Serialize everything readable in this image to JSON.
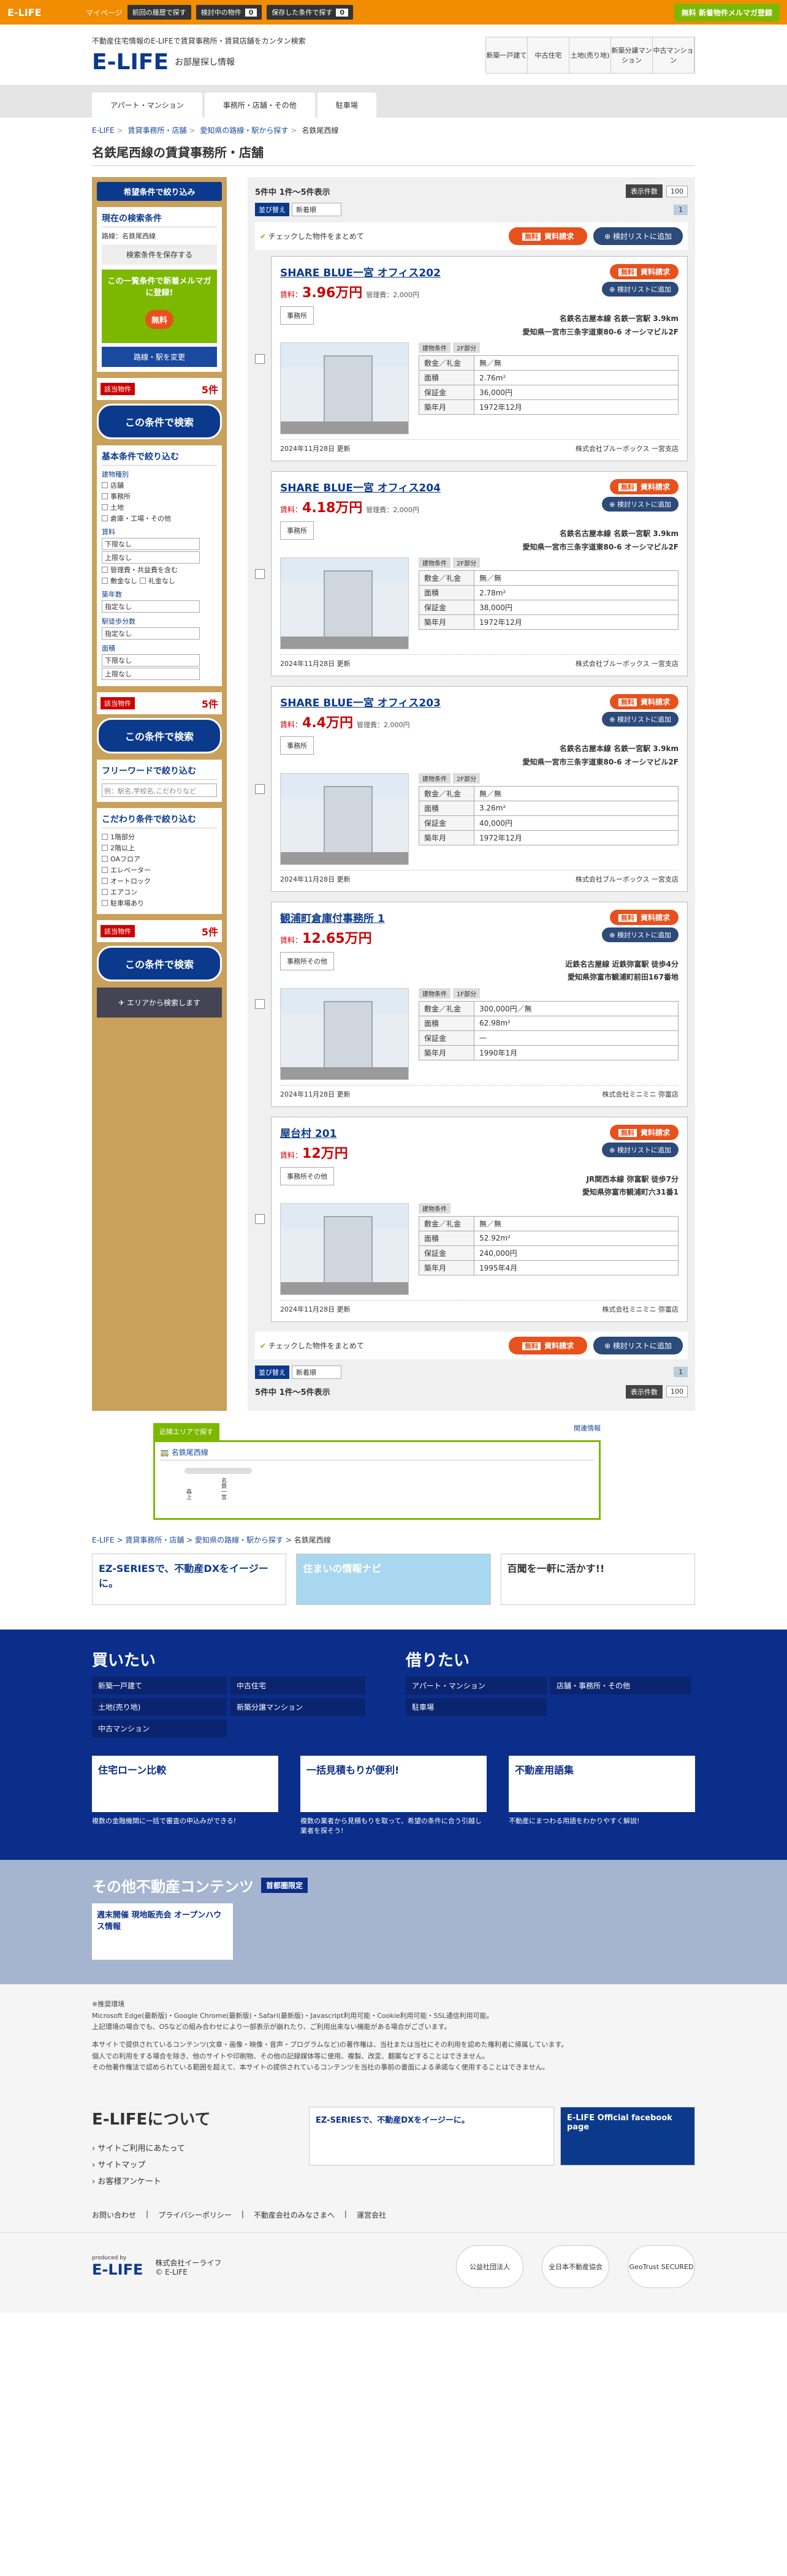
{
  "topbar": {
    "logo": "E-LIFE",
    "mypage": "マイページ",
    "history": "前回の履歴で探す",
    "compare": "検討中の物件",
    "compare_count": "0",
    "saved": "保存した条件で探す",
    "saved_count": "0",
    "mail_badge": "無料",
    "mail": "新着物件メルマガ登録"
  },
  "header": {
    "desc": "不動産住宅情報のE-LIFEで賃貸事務所・賃貸店舗をカンタン検索",
    "logo": "E-LIFE",
    "sub": "お部屋探し情報",
    "nav": [
      "新築一戸建て",
      "中古住宅",
      "土地(売り地)",
      "新築分譲マンション",
      "中古マンション"
    ]
  },
  "gnav": [
    "アパート・マンション",
    "事務所・店舗・その他",
    "駐車場"
  ],
  "breadcrumb": [
    "E-LIFE",
    "賃貸事務所・店舗",
    "愛知県の路線・駅から探す",
    "名鉄尾西線"
  ],
  "page_title": "名鉄尾西線の賃貸事務所・店舗",
  "side": {
    "header": "希望条件で絞り込み",
    "current_title": "現在の検索条件",
    "current_line": "路線：名鉄尾西線",
    "save_btn": "検索条件を保存する",
    "banner_text": "この一覧条件で新着メルマガに登録!",
    "banner_badge": "無料",
    "change_btn": "路線・駅を変更",
    "count_tag": "該当物件",
    "count": "5件",
    "go": "この条件で検索",
    "basic_title": "基本条件で絞り込む",
    "type_label": "建物種別",
    "types": [
      "店舗",
      "事務所",
      "土地",
      "倉庫・工場・その他"
    ],
    "rent_label": "賃料",
    "rent_low": "下限なし",
    "rent_high": "上限なし",
    "rent_opts": [
      "管理費・共益費を含む",
      "敷金なし",
      "礼金なし"
    ],
    "age_label": "築年数",
    "age_val": "指定なし",
    "walk_label": "駅徒歩分数",
    "walk_val": "指定なし",
    "area_label": "面積",
    "area_low": "下限なし",
    "area_high": "上限なし",
    "free_title": "フリーワードで絞り込む",
    "free_ph": "例：駅名,学校名,こだわりなど",
    "kodawari_title": "こだわり条件で絞り込む",
    "kodawari": [
      "1階部分",
      "2階以上",
      "OAフロア",
      "エレベーター",
      "オートロック",
      "エアコン",
      "駐車場あり"
    ],
    "area_search": "エリアから検索します"
  },
  "results": {
    "count_text": "5件中 1件～5件表示",
    "per_page_label": "表示件数",
    "per_page": "100",
    "sort_label": "並び替え",
    "sort_val": "新着順",
    "page": "1",
    "check_text": "チェックした物件をまとめて",
    "req_badge": "無料",
    "req": "資料請求",
    "add_list": "検討リストに追加",
    "listings": [
      {
        "name": "SHARE BLUE一宮 オフィス202",
        "rent_label": "賃料：",
        "rent": "3.96万円",
        "fee": "管理費：2,000円",
        "type": "事務所",
        "loc1": "名鉄名古屋本線 名鉄一宮駅 3.9km",
        "loc2": "愛知県一宮市三条字道東80-6 オーシマビル2F",
        "tags": [
          "建物条件",
          "2F部分"
        ],
        "rows": [
          [
            "敷金／礼金",
            "無／無"
          ],
          [
            "面積",
            "2.76m²"
          ],
          [
            "保証金",
            "36,000円"
          ],
          [
            "築年月",
            "1972年12月"
          ]
        ],
        "date": "2024年11月28日 更新",
        "agent": "株式会社ブルーボックス 一宮支店"
      },
      {
        "name": "SHARE BLUE一宮 オフィス204",
        "rent_label": "賃料：",
        "rent": "4.18万円",
        "fee": "管理費：2,000円",
        "type": "事務所",
        "loc1": "名鉄名古屋本線 名鉄一宮駅 3.9km",
        "loc2": "愛知県一宮市三条字道東80-6 オーシマビル2F",
        "tags": [
          "建物条件",
          "2F部分"
        ],
        "rows": [
          [
            "敷金／礼金",
            "無／無"
          ],
          [
            "面積",
            "2.78m²"
          ],
          [
            "保証金",
            "38,000円"
          ],
          [
            "築年月",
            "1972年12月"
          ]
        ],
        "date": "2024年11月28日 更新",
        "agent": "株式会社ブルーボックス 一宮支店"
      },
      {
        "name": "SHARE BLUE一宮 オフィス203",
        "rent_label": "賃料：",
        "rent": "4.4万円",
        "fee": "管理費：2,000円",
        "type": "事務所",
        "loc1": "名鉄名古屋本線 名鉄一宮駅 3.9km",
        "loc2": "愛知県一宮市三条字道東80-6 オーシマビル2F",
        "tags": [
          "建物条件",
          "2F部分"
        ],
        "rows": [
          [
            "敷金／礼金",
            "無／無"
          ],
          [
            "面積",
            "3.26m²"
          ],
          [
            "保証金",
            "40,000円"
          ],
          [
            "築年月",
            "1972年12月"
          ]
        ],
        "date": "2024年11月28日 更新",
        "agent": "株式会社ブルーボックス 一宮支店"
      },
      {
        "name": "観浦町倉庫付事務所 1",
        "rent_label": "賃料：",
        "rent": "12.65万円",
        "fee": "",
        "type": "事務所その他",
        "loc1": "近鉄名古屋線 近鉄弥富駅 徒歩4分",
        "loc2": "愛知県弥富市観浦町前田167番地",
        "tags": [
          "建物条件",
          "1F部分"
        ],
        "rows": [
          [
            "敷金／礼金",
            "300,000円／無"
          ],
          [
            "面積",
            "62.98m²"
          ],
          [
            "保証金",
            "—"
          ],
          [
            "築年月",
            "1990年1月"
          ]
        ],
        "date": "2024年11月28日 更新",
        "agent": "株式会社ミニミニ 弥富店"
      },
      {
        "name": "屋台村 201",
        "rent_label": "賃料：",
        "rent": "12万円",
        "fee": "",
        "type": "事務所その他",
        "loc1": "JR関西本線 弥富駅 徒歩7分",
        "loc2": "愛知県弥富市観浦町六31番1",
        "tags": [
          "建物条件"
        ],
        "rows": [
          [
            "敷金／礼金",
            "無／無"
          ],
          [
            "面積",
            "52.92m²"
          ],
          [
            "保証金",
            "240,000円"
          ],
          [
            "築年月",
            "1995年4月"
          ]
        ],
        "date": "2024年11月28日 更新",
        "agent": "株式会社ミニミニ 弥富店"
      }
    ]
  },
  "near": {
    "tab": "近隣エリアで探す",
    "rel": "関連情報",
    "line": "名鉄尾西線",
    "stations": [
      "森上",
      "名鉄一宮"
    ]
  },
  "banners": [
    "EZ-SERIESで、不動産DXをイージーに。",
    "住まいの情報ナビ",
    "百聞を一軒に活かす!!"
  ],
  "buy": {
    "title": "買いたい",
    "links": [
      "新築一戸建て",
      "中古住宅",
      "土地(売り地)",
      "新築分譲マンション",
      "中古マンション"
    ]
  },
  "rent": {
    "title": "借りたい",
    "links": [
      "アパート・マンション",
      "店舗・事務所・その他",
      "駐車場"
    ]
  },
  "blue_banners": [
    {
      "title": "住宅ローン比較",
      "text": "複数の金融機関に一括で審査の申込みができる!"
    },
    {
      "title": "一括見積もりが便利!",
      "text": "複数の業者から見積もりを取って、希望の条件に合う引越し業者を探そう!"
    },
    {
      "title": "不動産用語集",
      "text": "不動産にまつわる用語をわかりやすく解説!"
    }
  ],
  "other": {
    "title": "その他不動産コンテンツ",
    "badge": "首都圏限定",
    "oh": "週末開催 現地販売会 オープンハウス情報"
  },
  "notes": [
    "※推奨環境",
    "Microsoft Edge(最新版)・Google Chrome(最新版)・Safari(最新版)・Javascript利用可能・Cookie利用可能・SSL通信利用可能。",
    "上記環境の場合でも、OSなどの組み合わせにより一部表示が崩れたり、ご利用出来ない機能がある場合がございます。",
    "本サイトで提供されているコンテンツ(文章・画像・映像・音声・プログラムなど)の著作権は、当社または当社にその利用を認めた権利者に帰属しています。",
    "個人での利用をする場合を除き、他のサイトや印刷物、その他の記録媒体等に使用、複製、改変、翻案などすることはできません。",
    "その他著作権法で認められている範囲を超えて、本サイトの提供されているコンテンツを当社の事前の書面による承諾なく使用することはできません。"
  ],
  "about": {
    "title": "E-LIFEについて",
    "links": [
      "サイトご利用にあたって",
      "サイトマップ",
      "お客様アンケート"
    ],
    "ez": "EZ-SERIESで、不動産DXをイージーに。",
    "fb": "E-LIFE Official facebook page"
  },
  "footer_links": [
    "お問い合わせ",
    "プライバシーポリシー",
    "不動産会社のみなさまへ",
    "運営会社"
  ],
  "footer": {
    "produced": "produced by",
    "logo": "E-LIFE",
    "company": "株式会社イーライフ",
    "copy": "© E-LIFE",
    "seals": [
      "公益社団法人",
      "全日本不動産協会",
      "GeoTrust SECURED"
    ]
  },
  "colors": {
    "accent": "#f28c00",
    "brand": "#0b3a8c",
    "red": "#e8511c",
    "green": "#7cb800"
  }
}
